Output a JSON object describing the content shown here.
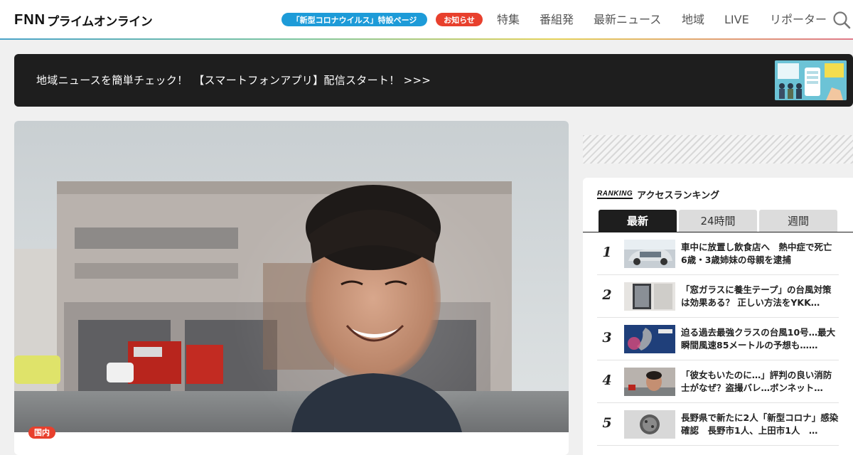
{
  "header": {
    "logo_main": "FNN",
    "logo_sub": "プライムオンライン",
    "covid_pill": "「新型コロナウイルス」特設ページ",
    "news_pill": "お知らせ",
    "nav": [
      "特集",
      "番組発",
      "最新ニュース",
      "地域",
      "LIVE",
      "リポーター"
    ],
    "search_icon": "search-icon"
  },
  "banner": {
    "text": "地域ニュースを簡単チェック！　【スマートフォンアプリ】配信スタート！ >>>"
  },
  "article": {
    "category": "国内"
  },
  "ranking": {
    "logo": "RANKING",
    "title": "アクセスランキング",
    "tabs": [
      "最新",
      "24時間",
      "週間"
    ],
    "items": [
      {
        "rank": "1",
        "title": "車中に放置し飲食店へ　熱中症で死亡 6歳・3歳姉妹の母親を逮捕"
      },
      {
        "rank": "2",
        "title": "「窓ガラスに養生テープ」の台風対策は効果ある？ 正しい方法をYKK…"
      },
      {
        "rank": "3",
        "title": "迫る過去最強クラスの台風10号…最大瞬間風速85メートルの予想も……"
      },
      {
        "rank": "4",
        "title": "「彼女もいたのに…」評判の良い消防士がなぜ？盗撮バレ…ボンネット…"
      },
      {
        "rank": "5",
        "title": "長野県で新たに2人「新型コロナ」感染確認　長野市1人、上田市1人　…"
      }
    ]
  },
  "colors": {
    "covid_pill": "#1d9bd8",
    "news_pill": "#e8402d",
    "banner_bg": "#1e1e1e",
    "active_tab": "#1e1e1e"
  }
}
